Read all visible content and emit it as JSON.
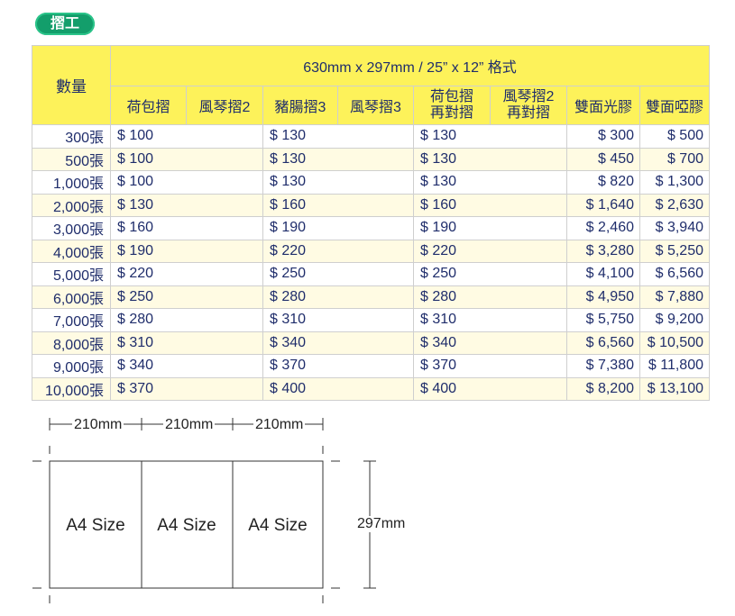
{
  "badge": "摺工",
  "table": {
    "qty_header": "數量",
    "format_header": "630mm x 297mm / 25” x 12” 格式",
    "sub_headers": {
      "c1": "荷包摺",
      "c2": "風琴摺2",
      "c3": "豬腸摺3",
      "c4": "風琴摺3",
      "c5a": "荷包摺",
      "c5b": "再對摺",
      "c6a": "風琴摺2",
      "c6b": "再對摺",
      "c7": "雙面光膠",
      "c8": "雙面啞膠"
    },
    "rows": [
      {
        "qty": "300張",
        "p1": "$ 100",
        "p2": "$ 130",
        "p3": "$ 130",
        "p4": "$ 300",
        "p5": "$ 500"
      },
      {
        "qty": "500張",
        "p1": "$ 100",
        "p2": "$ 130",
        "p3": "$ 130",
        "p4": "$ 450",
        "p5": "$ 700"
      },
      {
        "qty": "1,000張",
        "p1": "$ 100",
        "p2": "$ 130",
        "p3": "$ 130",
        "p4": "$ 820",
        "p5": "$ 1,300"
      },
      {
        "qty": "2,000張",
        "p1": "$ 130",
        "p2": "$ 160",
        "p3": "$ 160",
        "p4": "$ 1,640",
        "p5": "$ 2,630"
      },
      {
        "qty": "3,000張",
        "p1": "$ 160",
        "p2": "$ 190",
        "p3": "$ 190",
        "p4": "$ 2,460",
        "p5": "$ 3,940"
      },
      {
        "qty": "4,000張",
        "p1": "$ 190",
        "p2": "$ 220",
        "p3": "$ 220",
        "p4": "$ 3,280",
        "p5": "$ 5,250"
      },
      {
        "qty": "5,000張",
        "p1": "$ 220",
        "p2": "$ 250",
        "p3": "$ 250",
        "p4": "$ 4,100",
        "p5": "$ 6,560"
      },
      {
        "qty": "6,000張",
        "p1": "$ 250",
        "p2": "$ 280",
        "p3": "$ 280",
        "p4": "$ 4,950",
        "p5": "$ 7,880"
      },
      {
        "qty": "7,000張",
        "p1": "$ 280",
        "p2": "$ 310",
        "p3": "$ 310",
        "p4": "$ 5,750",
        "p5": "$ 9,200"
      },
      {
        "qty": "8,000張",
        "p1": "$ 310",
        "p2": "$ 340",
        "p3": "$ 340",
        "p4": "$ 6,560",
        "p5": "$ 10,500"
      },
      {
        "qty": "9,000張",
        "p1": "$ 340",
        "p2": "$ 370",
        "p3": "$ 370",
        "p4": "$ 7,380",
        "p5": "$ 11,800"
      },
      {
        "qty": "10,000張",
        "p1": "$ 370",
        "p2": "$ 400",
        "p3": "$ 400",
        "p4": "$ 8,200",
        "p5": "$ 13,100"
      }
    ]
  },
  "diagram": {
    "width_label_1": "210mm",
    "width_label_2": "210mm",
    "width_label_3": "210mm",
    "height_label": "297mm",
    "panel_label_1": "A4 Size",
    "panel_label_2": "A4 Size",
    "panel_label_3": "A4 Size"
  },
  "colors": {
    "header_yellow": "#fdf25a",
    "row_alt": "#fffbe3",
    "badge_green": "#139e6b",
    "text_navy": "#1f2d6b"
  }
}
